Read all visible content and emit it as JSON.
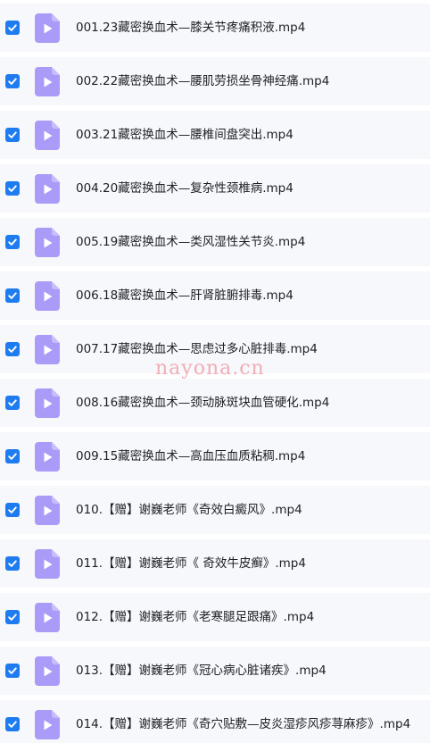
{
  "files": [
    {
      "name": "001.23藏密换血术—膝关节疼痛积液.mp4",
      "selected": true,
      "icon": "video-file-icon"
    },
    {
      "name": "002.22藏密换血术—腰肌劳损坐骨神经痛.mp4",
      "selected": true,
      "icon": "video-file-icon"
    },
    {
      "name": "003.21藏密换血术—腰椎间盘突出.mp4",
      "selected": true,
      "icon": "video-file-icon"
    },
    {
      "name": "004.20藏密换血术—复杂性颈椎病.mp4",
      "selected": true,
      "icon": "video-file-icon"
    },
    {
      "name": "005.19藏密换血术—类风湿性关节炎.mp4",
      "selected": true,
      "icon": "video-file-icon"
    },
    {
      "name": "006.18藏密换血术—肝肾脏腑排毒.mp4",
      "selected": true,
      "icon": "video-file-icon"
    },
    {
      "name": "007.17藏密换血术—思虑过多心脏排毒.mp4",
      "selected": true,
      "icon": "video-file-icon"
    },
    {
      "name": "008.16藏密换血术—颈动脉斑块血管硬化.mp4",
      "selected": true,
      "icon": "video-file-icon"
    },
    {
      "name": "009.15藏密换血术—高血压血质粘稠.mp4",
      "selected": true,
      "icon": "video-file-icon"
    },
    {
      "name": "010.【赠】谢巍老师《奇效白癜风》.mp4",
      "selected": true,
      "icon": "video-file-icon"
    },
    {
      "name": "011.【赠】谢巍老师《 奇效牛皮癣》.mp4",
      "selected": true,
      "icon": "video-file-icon"
    },
    {
      "name": "012.【赠】谢巍老师《老寒腿足跟痛》.mp4",
      "selected": true,
      "icon": "video-file-icon"
    },
    {
      "name": "013.【赠】谢巍老师《冠心病心脏诸疾》.mp4",
      "selected": true,
      "icon": "video-file-icon"
    },
    {
      "name": "014.【赠】谢巍老师《奇穴贴敷—皮炎湿疹风疹荨麻疹》.mp4",
      "selected": true,
      "icon": "video-file-icon"
    }
  ],
  "watermark": "nayona.cn",
  "colors": {
    "checkbox": "#1f7cf0",
    "file_icon": "#a99bf7",
    "row_background": "#f7f8fc",
    "text": "#1e1f24"
  }
}
